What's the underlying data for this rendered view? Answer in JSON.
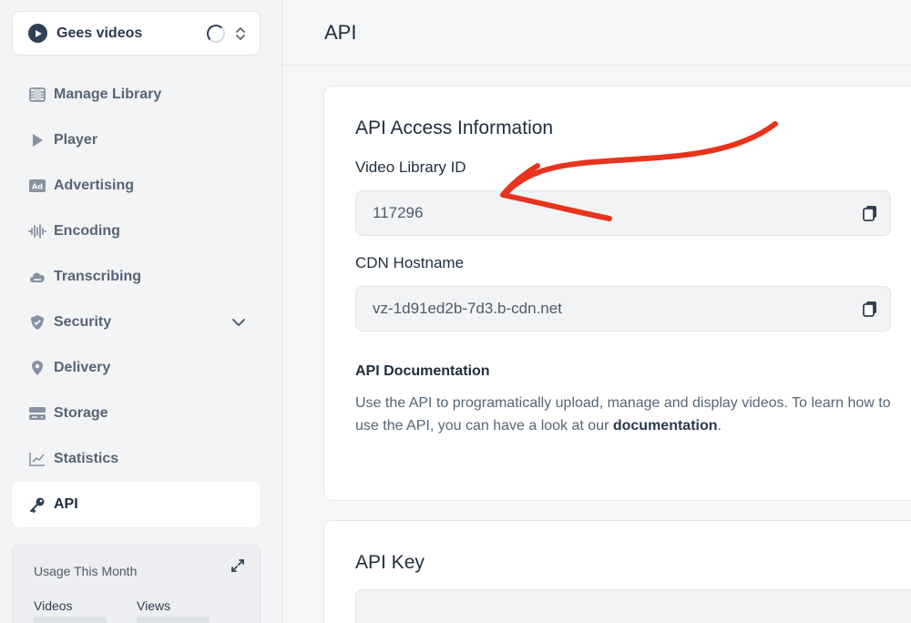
{
  "sidebar": {
    "library_name": "Gees videos",
    "items": [
      {
        "label": "Manage Library",
        "icon": "film-icon"
      },
      {
        "label": "Player",
        "icon": "play-icon"
      },
      {
        "label": "Advertising",
        "icon": "ad-icon"
      },
      {
        "label": "Encoding",
        "icon": "waveform-icon"
      },
      {
        "label": "Transcribing",
        "icon": "cloud-icon"
      },
      {
        "label": "Security",
        "icon": "shield-icon"
      },
      {
        "label": "Delivery",
        "icon": "map-pin-icon"
      },
      {
        "label": "Storage",
        "icon": "storage-icon"
      },
      {
        "label": "Statistics",
        "icon": "chart-line-icon"
      },
      {
        "label": "API",
        "icon": "key-icon"
      }
    ],
    "active_item": "API",
    "usage": {
      "title": "Usage This Month",
      "col1": "Videos",
      "col2": "Views"
    }
  },
  "header": {
    "title": "API"
  },
  "access": {
    "title": "API Access Information",
    "library_id_label": "Video Library ID",
    "library_id_value": "117296",
    "cdn_label": "CDN Hostname",
    "cdn_value": "vz-1d91ed2b-7d3.b-cdn.net",
    "doc_title": "API Documentation",
    "doc_text_1": "Use the API to programatically upload, manage and display videos. To learn how to use the API, you can have a look at our ",
    "doc_link": "documentation",
    "doc_text_2": "."
  },
  "api_key": {
    "title": "API Key"
  },
  "colors": {
    "accent": "#2f4056",
    "annotation_arrow": "#e8341c",
    "icon_gray": "#8592a3"
  }
}
